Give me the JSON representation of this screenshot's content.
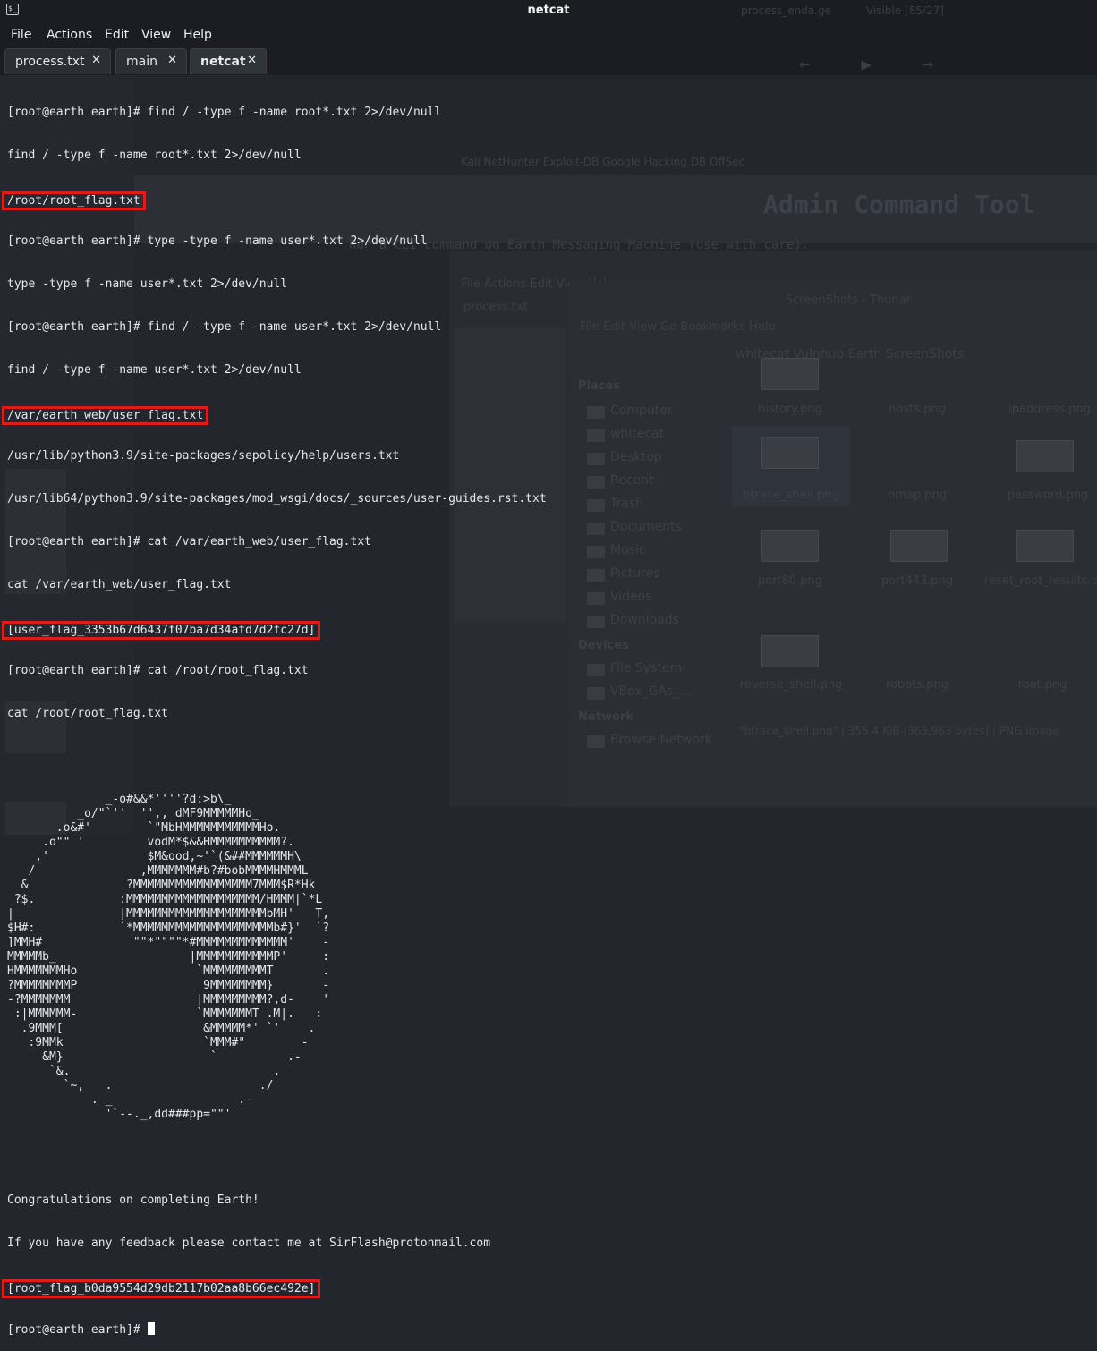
{
  "window": {
    "icon": "terminal-icon",
    "title": "netcat",
    "ghost_title": "process_enda.ge",
    "ghost_title_right": "Visible [85/27]"
  },
  "menu": [
    "File",
    "Actions",
    "Edit",
    "View",
    "Help"
  ],
  "tabs": [
    {
      "label": "process.txt",
      "close": "✕"
    },
    {
      "label": "main",
      "close": "✕"
    },
    {
      "label": "netcat",
      "close": "✕",
      "active": true
    }
  ],
  "nav_arrows": "← ▶ →",
  "terminal": {
    "lines_a": [
      "[root@earth earth]# find / -type f -name root*.txt 2>/dev/null",
      "find / -type f -name root*.txt 2>/dev/null"
    ],
    "hl_root_path": "/root/root_flag.txt",
    "lines_b": [
      "[root@earth earth]# type -type f -name user*.txt 2>/dev/null",
      "type -type f -name user*.txt 2>/dev/null",
      "[root@earth earth]# find / -type f -name user*.txt 2>/dev/null",
      "find / -type f -name user*.txt 2>/dev/null"
    ],
    "hl_user_path": "/var/earth_web/user_flag.txt",
    "lines_c": [
      "/usr/lib/python3.9/site-packages/sepolicy/help/users.txt",
      "/usr/lib64/python3.9/site-packages/mod_wsgi/docs/_sources/user-guides.rst.txt",
      "[root@earth earth]# cat /var/earth_web/user_flag.txt",
      "cat /var/earth_web/user_flag.txt"
    ],
    "hl_user_flag": "[user_flag_3353b67d6437f07ba7d34afd7d2fc27d]",
    "lines_d": [
      "[root@earth earth]# cat /root/root_flag.txt",
      "cat /root/root_flag.txt",
      ""
    ],
    "ascii_art": "              _-o#&&*''''?d:>b\\_\n          _o/\"`''  '',, dMF9MMMMMHo_\n       .o&#'        `\"MbHMMMMMMMMMMMHo.\n     .o\"\" '         vodM*$&&HMMMMMMMMMM?.\n    ,'              $M&ood,~'`(&##MMMMMMH\\\n   /               ,MMMMMMM#b?#bobMMMMHMMML\n  &              ?MMMMMMMMMMMMMMMMM7MMM$R*Hk\n ?$.            :MMMMMMMMMMMMMMMMMMM/HMMM|`*L\n|               |MMMMMMMMMMMMMMMMMMMMbMH'   T,\n$H#:            `*MMMMMMMMMMMMMMMMMMMMb#}'  `?\n]MMH#             \"\"*\"\"\"\"*#MMMMMMMMMMMMM'    -\nMMMMMb_                   |MMMMMMMMMMMP'     :\nHMMMMMMMHo                 `MMMMMMMMMT       .\n?MMMMMMMMP                  9MMMMMMMM}       -\n-?MMMMMMM                  |MMMMMMMMM?,d-    '\n :|MMMMMM-                 `MMMMMMMT .M|.   :\n  .9MMM[                    &MMMMM*' `'    .\n   :9MMk                    `MMM#\"        -\n     &M}                     `          .-\n      `&.                             .\n        `~,   .                     ./\n            . _                  .-\n              '`--._,dd###pp=\"\"'",
    "lines_e": [
      "",
      "Congratulations on completing Earth!",
      "If you have any feedback please contact me at SirFlash@protonmail.com"
    ],
    "hl_root_flag": "[root_flag_b0da9554d29db2117b02aa8b66ec492e]",
    "prompt": "[root@earth earth]# "
  },
  "background": {
    "heading": "Admin Command Tool",
    "subtitle": "Run a CLI command on Earth Messaging Machine (use with care).",
    "bookmarks": "Kali NetHunter   Exploit-DB   Google Hacking DB   OffSec",
    "ghost_menu": "File  Actions  Edit  View  Help",
    "ghost_tab": "process.txt",
    "fm_menu": "File   Edit   View   Go   Bookmarks   Help",
    "fm_title": "ScreenShots - Thunar",
    "fm_path": "whitecat   Vulnhub   Earth   ScreenShots",
    "places_header": "Places",
    "places": [
      "Computer",
      "whitecat",
      "Desktop",
      "Recent",
      "Trash",
      "Documents",
      "Music",
      "Pictures",
      "Videos",
      "Downloads"
    ],
    "devices_header": "Devices",
    "devices": [
      "File System",
      "VBox_GAs_..."
    ],
    "network_header": "Network",
    "network": [
      "Browse Network"
    ],
    "files": [
      "history.png",
      "hosts.png",
      "ipaddress.png",
      "btrace_shell.png",
      "nmap.png",
      "password.png",
      "port80.png",
      "port443.png",
      "reset_root_results.png",
      "reverse_shell.png",
      "robots.png",
      "root.png"
    ],
    "status": "\"btrace_shell.png\" | 355.4 KiB (363,963 bytes) | PNG image"
  }
}
